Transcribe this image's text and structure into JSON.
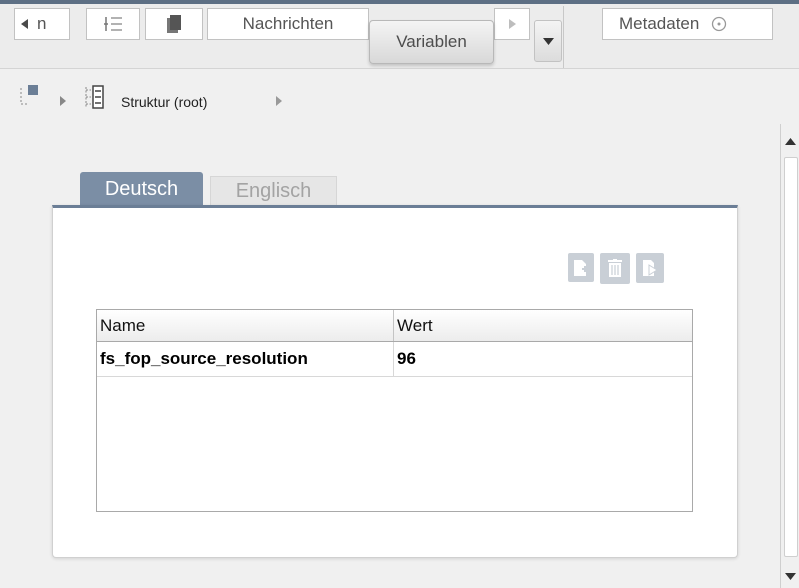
{
  "toolbar": {
    "partial_label": "n",
    "tab_nachrichten": "Nachrichten",
    "tab_variablen": "Variablen",
    "tab_metadaten": "Metadaten"
  },
  "breadcrumb": {
    "root_label": "Struktur (root)"
  },
  "language_tabs": [
    {
      "label": "Deutsch",
      "active": true
    },
    {
      "label": "Englisch",
      "active": false
    }
  ],
  "table": {
    "columns": [
      "Name",
      "Wert"
    ],
    "rows": [
      {
        "name": "fs_fop_source_resolution",
        "value": "96"
      }
    ]
  },
  "icons": {
    "scroll_left": "triangle-left-icon",
    "list": "numbered-list-icon",
    "copy": "document-copy-icon",
    "scroll_right": "triangle-right-icon",
    "dropdown": "caret-down-icon",
    "metadata": "circle-icon",
    "tree_node": "tree-node-icon",
    "structure": "structure-icon",
    "add": "add-row-icon",
    "delete": "trash-icon",
    "export": "export-icon"
  },
  "colors": {
    "accent": "#6b7e96",
    "tab_active_bg": "#7b8ea5",
    "tab_inactive_bg": "#e6e6e6"
  }
}
